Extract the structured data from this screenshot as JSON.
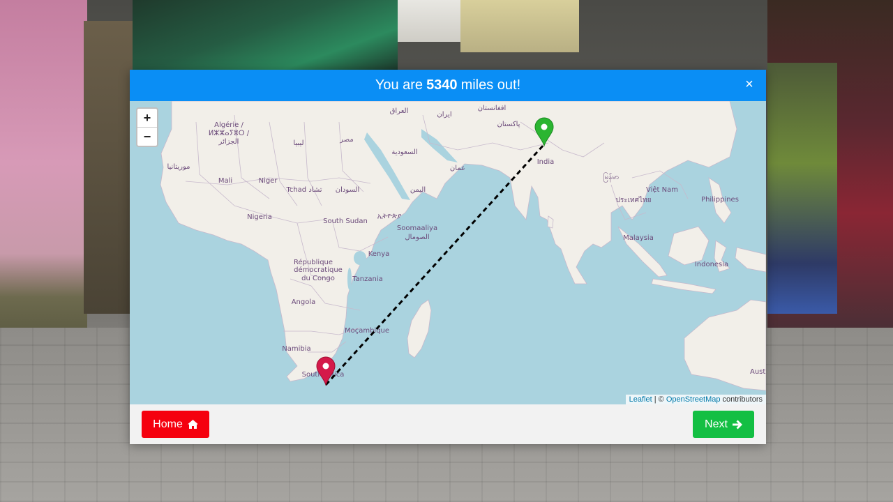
{
  "result": {
    "prefix": "You are",
    "distance": "5340",
    "suffix": "miles out!",
    "close": "×"
  },
  "map": {
    "zoom_in": "+",
    "zoom_out": "−",
    "attribution": {
      "leaflet": "Leaflet",
      "separator": " | © ",
      "osm": "OpenStreetMap",
      "contributors": " contributors"
    },
    "labels": {
      "algerie": "Algérie /",
      "algerie_tifinagh": "ⵍⵣⵣⴰⵢⴻⵔ /",
      "algerie_arabic": "الجزائر",
      "libya": "ليبيا",
      "egypt": "مصر",
      "iraq": "العراق",
      "iran": "ایران",
      "afghanistan": "افغانستان",
      "pakistan": "پاکستان",
      "saudi": "السعودية",
      "oman": "عمان",
      "yemen": "اليمن",
      "mauritania": "موريتانيا",
      "mali": "Mali",
      "niger": "Niger",
      "tchad": "Tchad تشاد",
      "sudan": "السودان",
      "ethiopia": "ኢትዮጵያ",
      "south_sudan": "South Sudan",
      "nigeria": "Nigeria",
      "somalia": "Soomaaliya",
      "somalia_arabic": "الصومال",
      "kenya": "Kenya",
      "drc1": "République",
      "drc2": "démocratique",
      "drc3": "du Congo",
      "tanzania": "Tanzania",
      "angola": "Angola",
      "mozambique": "Moçambique",
      "namibia": "Namibia",
      "south_africa": "South Africa",
      "india": "India",
      "myanmar": "မြန်မာ",
      "vietnam": "Việt Nam",
      "thailand": "ประเทศไทย",
      "philippines": "Philippines",
      "malaysia": "Malaysia",
      "indonesia": "Indonesia",
      "australia": "Aust"
    }
  },
  "footer": {
    "home_label": "Home",
    "next_label": "Next"
  },
  "colors": {
    "header": "#0a8ef5",
    "home": "#f5000e",
    "next": "#13bf43",
    "water": "#aad3df",
    "land": "#f2efe9",
    "guess_marker": "#d41a4a",
    "actual_marker": "#2bb531"
  }
}
